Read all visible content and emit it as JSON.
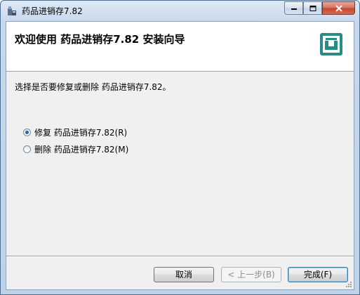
{
  "window": {
    "title": "药品进销存7.82",
    "icon": "installer-app-icon"
  },
  "banner": {
    "title": "欢迎使用 药品进销存7.82 安装向导",
    "logo": "setup-wizard-logo-icon"
  },
  "main": {
    "prompt": "选择是否要修复或删除 药品进销存7.82。",
    "options": [
      {
        "label": "修复 药品进销存7.82(R)",
        "selected": true
      },
      {
        "label": "删除 药品进销存7.82(M)",
        "selected": false
      }
    ]
  },
  "footer": {
    "cancel_label": "取消",
    "back_label": "< 上一步(B)",
    "finish_label": "完成(F)"
  },
  "colors": {
    "accent": "#2c62b5",
    "logo": "#2a8a86"
  }
}
